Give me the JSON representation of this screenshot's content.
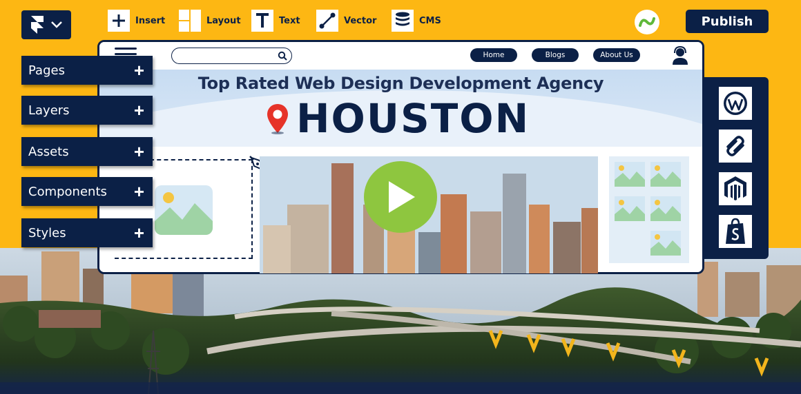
{
  "toolbar": {
    "insert_label": "Insert",
    "layout_label": "Layout",
    "text_label": "Text",
    "vector_label": "Vector",
    "cms_label": "CMS",
    "publish_label": "Publish"
  },
  "panel": {
    "items": [
      {
        "label": "Pages"
      },
      {
        "label": "Layers"
      },
      {
        "label": "Assets"
      },
      {
        "label": "Components"
      },
      {
        "label": "Styles"
      }
    ],
    "plus_glyph": "+"
  },
  "site": {
    "search_placeholder": "",
    "nav": [
      "Home",
      "Blogs",
      "About Us"
    ],
    "headline": "Top Rated Web Design Development Agency",
    "city": "HOUSTON"
  },
  "cms_platforms": [
    "wordpress-icon",
    "squarespace-icon",
    "magento-icon",
    "shopify-icon"
  ],
  "colors": {
    "background": "#fdb713",
    "navy": "#0b2046",
    "play_green": "#8ec63f",
    "pin_red": "#e63329"
  }
}
